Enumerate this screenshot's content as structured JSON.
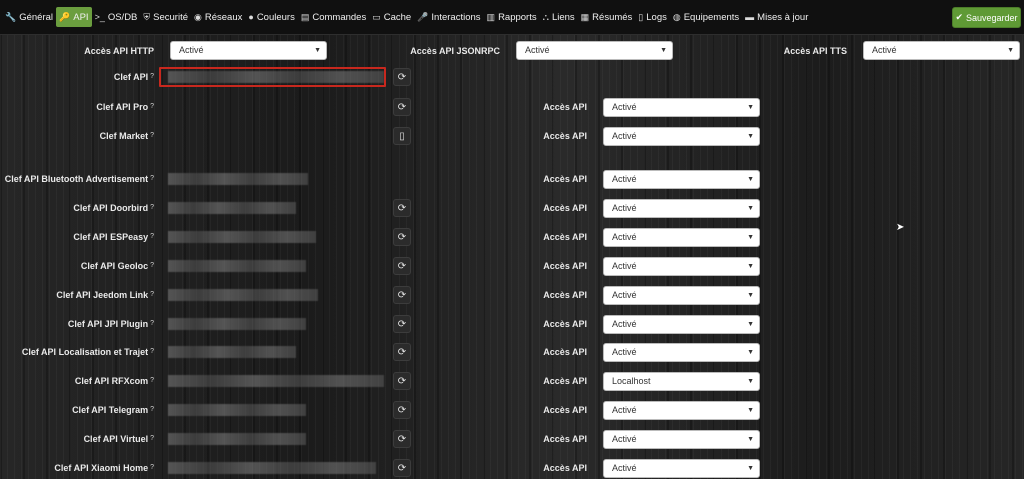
{
  "tabs": [
    {
      "label": "Général",
      "icon": "wrench-icon",
      "glyph": "🔧",
      "active": false
    },
    {
      "label": "API",
      "icon": "key-icon",
      "glyph": "🔑",
      "active": true
    },
    {
      "label": "OS/DB",
      "icon": "terminal-icon",
      "glyph": ">_",
      "active": false
    },
    {
      "label": "Securité",
      "icon": "shield-icon",
      "glyph": "⛨",
      "active": false
    },
    {
      "label": "Réseaux",
      "icon": "rss-icon",
      "glyph": "◉",
      "active": false
    },
    {
      "label": "Couleurs",
      "icon": "tint-icon",
      "glyph": "●",
      "active": false
    },
    {
      "label": "Commandes",
      "icon": "list-icon",
      "glyph": "▤",
      "active": false
    },
    {
      "label": "Cache",
      "icon": "hdd-icon",
      "glyph": "▭",
      "active": false
    },
    {
      "label": "Interactions",
      "icon": "microphone-icon",
      "glyph": "🎤",
      "active": false
    },
    {
      "label": "Rapports",
      "icon": "newspaper-icon",
      "glyph": "▥",
      "active": false
    },
    {
      "label": "Liens",
      "icon": "sitemap-icon",
      "glyph": "⛬",
      "active": false
    },
    {
      "label": "Résumés",
      "icon": "table-icon",
      "glyph": "▦",
      "active": false
    },
    {
      "label": "Logs",
      "icon": "file-icon",
      "glyph": "▯",
      "active": false
    },
    {
      "label": "Equipements",
      "icon": "globe-icon",
      "glyph": "◍",
      "active": false
    },
    {
      "label": "Mises à jour",
      "icon": "credit-card-icon",
      "glyph": "▬",
      "active": false
    }
  ],
  "save_label": "Sauvegarder",
  "top_row": {
    "http": {
      "label": "Accès API HTTP",
      "value": "Activé"
    },
    "jsonrpc": {
      "label": "Accès API JSONRPC",
      "value": "Activé"
    },
    "tts": {
      "label": "Accès API TTS",
      "value": "Activé"
    }
  },
  "acces_label": "Accès API",
  "keys": [
    {
      "label": "Clef API",
      "has_key": true,
      "has_refresh": true,
      "acces": ""
    },
    {
      "label": "Clef API Pro",
      "has_key": false,
      "has_refresh": true,
      "acces": "Activé"
    },
    {
      "label": "Clef Market",
      "has_key": false,
      "has_refresh": true,
      "acces": "Activé"
    },
    {
      "label": "Clef API Bluetooth Advertisement",
      "has_key": true,
      "has_refresh": false,
      "acces": "Activé"
    },
    {
      "label": "Clef API Doorbird",
      "has_key": true,
      "has_refresh": true,
      "acces": "Activé"
    },
    {
      "label": "Clef API ESPeasy",
      "has_key": true,
      "has_refresh": true,
      "acces": "Activé"
    },
    {
      "label": "Clef API Geoloc",
      "has_key": true,
      "has_refresh": true,
      "acces": "Activé"
    },
    {
      "label": "Clef API Jeedom Link",
      "has_key": true,
      "has_refresh": true,
      "acces": "Activé"
    },
    {
      "label": "Clef API JPI Plugin",
      "has_key": true,
      "has_refresh": true,
      "acces": "Activé"
    },
    {
      "label": "Clef API Localisation et Trajet",
      "has_key": true,
      "has_refresh": true,
      "acces": "Activé"
    },
    {
      "label": "Clef API RFXcom",
      "has_key": true,
      "has_refresh": true,
      "acces": "Localhost"
    },
    {
      "label": "Clef API Telegram",
      "has_key": true,
      "has_refresh": true,
      "acces": "Activé"
    },
    {
      "label": "Clef API Virtuel",
      "has_key": true,
      "has_refresh": true,
      "acces": "Activé"
    },
    {
      "label": "Clef API Xiaomi Home",
      "has_key": true,
      "has_refresh": true,
      "acces": "Activé"
    }
  ]
}
